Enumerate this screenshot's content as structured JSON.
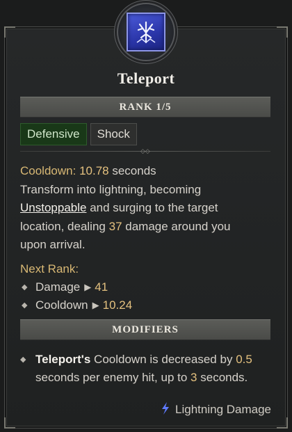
{
  "skill": {
    "name": "Teleport",
    "icon": "teleport-lightning-icon",
    "rank_label": "RANK 1/5",
    "tags": [
      "Defensive",
      "Shock"
    ]
  },
  "description": {
    "cooldown_label": "Cooldown:",
    "cooldown_value": "10.78",
    "cooldown_unit": "seconds",
    "text_1": "Transform into lightning, becoming",
    "keyword": "Unstoppable",
    "text_2": "and surging to the target location, dealing",
    "damage_value": "37",
    "text_3": "damage around you upon arrival."
  },
  "next_rank": {
    "label": "Next Rank:",
    "items": [
      {
        "stat": "Damage",
        "value": "41"
      },
      {
        "stat": "Cooldown",
        "value": "10.24"
      }
    ]
  },
  "modifiers": {
    "header": "MODIFIERS",
    "item": {
      "subject": "Teleport's",
      "text_1": "Cooldown is decreased by",
      "value_1": "0.5",
      "text_2": "seconds per enemy hit, up to",
      "value_2": "3",
      "text_3": "seconds."
    }
  },
  "damage_type": {
    "icon": "lightning-bolt-icon",
    "label": "Lightning Damage"
  },
  "colors": {
    "highlight": "#e4c17f",
    "defensive_tag": "#193818",
    "lightning": "#5f7bff"
  }
}
